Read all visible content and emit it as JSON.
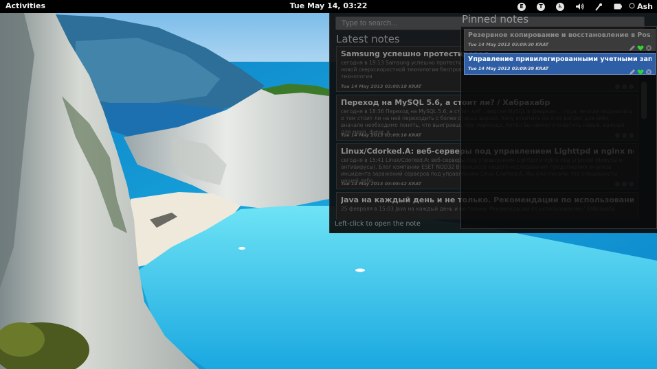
{
  "topbar": {
    "activities": "Activities",
    "clock": "Tue May 14, 03:22",
    "user": "Ash",
    "tray_icons": [
      {
        "icon": "e-indicator-icon",
        "glyph": "E"
      },
      {
        "icon": "t-indicator-icon",
        "glyph": "T"
      },
      {
        "icon": "accessibility-icon",
        "glyph": "♿"
      },
      {
        "icon": "volume-icon",
        "glyph": "🔊"
      },
      {
        "icon": "network-icon",
        "glyph": "⁄"
      },
      {
        "icon": "battery-icon",
        "glyph": "▮"
      }
    ]
  },
  "search": {
    "placeholder": "Type to search..."
  },
  "latest": {
    "title": "Latest notes",
    "hint": "Left-click to open the note",
    "notes": [
      {
        "title": "Samsung успешно протестировал...",
        "body": "сегодня в 19:13 Samsung успешно протестировал беспроводные технологии* В понедельник компания... новой сверхскоростной технологии беспроводной... смотрится черепахой из бронзового века. Новая технология",
        "date": "Tue 14 May 2013 03:09:18 KRAT"
      },
      {
        "title": "Переход на MySQL 5.6, а стоит ли? / Хабрахабр",
        "body": "сегодня в 18:36 Переход на MySQL 5.6, а стоит ли? ...версии MySQL в феврале ... года, многие задумались о том стоит ли на неё переходить с более старых версий. Хочу ответить на этот вопрос для себя, вначале необходимо понять, что выиграешь при переходе. Хотел бы немного осветить новые, важные для меня, фичи, к",
        "date": "Tue 14 May 2013 03:09:16 KRAT"
      },
      {
        "title": "Linux/Cdorked.A: веб-серверы под управлением Lighttpd и nginx под уг...",
        "body": "сегодня в 15:41 Linux/Cdorked.A: веб-серверы под управлением Lighttpd и nginx под угрозой (Вирусы и антивирусы). Блог компании ESET NOD32 В процессе нашего исследования продолжения анализа инцидента заражений серверов под управлением Linux Cdorked.A. Мы уже писали, что специалисты нашей лабо...",
        "date": "Tue 14 May 2013 03:08:42 KRAT"
      },
      {
        "title": "Java на каждый день и не только. Рекомендации по использованию / X...",
        "body": "25 февраля в 15:03 Java на каждый день и не только. Рекомендации по использованию / Хабрахабр",
        "date": ""
      }
    ]
  },
  "pinned": {
    "title": "Pinned notes",
    "notes": [
      {
        "title": "Резервное копирование и восстановление в Pos...",
        "date": "Tue 14 May 2013 03:09:30 KRAT",
        "selected": false
      },
      {
        "title": "Управление привилегированными учетными зап...",
        "date": "Tue 14 May 2013 03:09:39 KRAT",
        "selected": true
      }
    ]
  },
  "colors": {
    "pin_selected": "#2e5ea6",
    "heart": "#2fd52f",
    "sea": "#1aa8e0"
  }
}
